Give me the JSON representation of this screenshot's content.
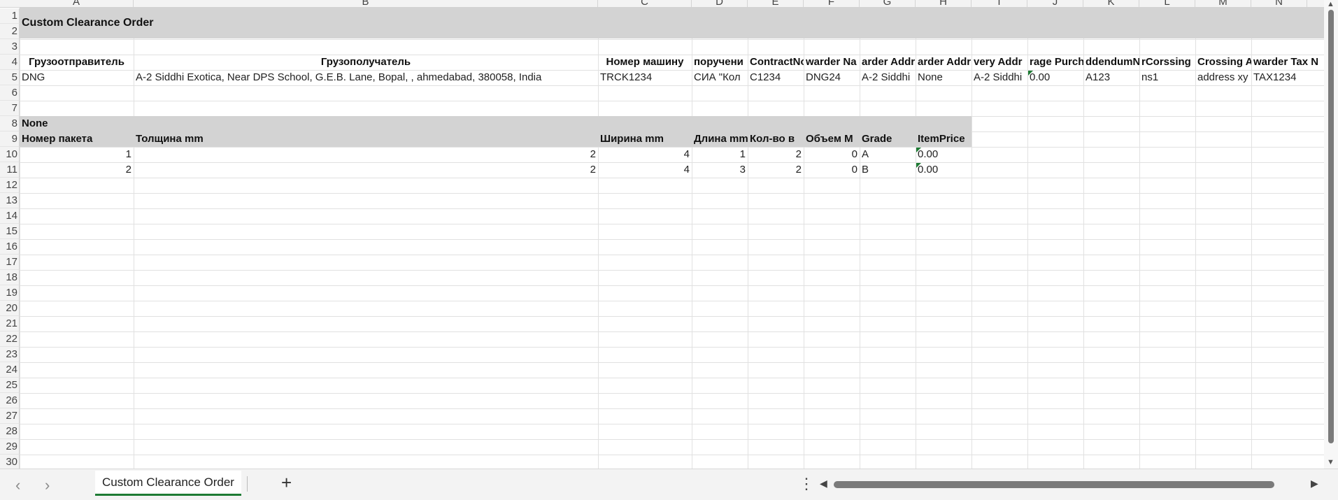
{
  "columns": [
    "A",
    "B",
    "C",
    "D",
    "E",
    "F",
    "G",
    "H",
    "I",
    "J",
    "K",
    "L",
    "M",
    "N"
  ],
  "rows": [
    "1",
    "2",
    "3",
    "4",
    "5",
    "6",
    "7",
    "8",
    "9",
    "10",
    "11",
    "12",
    "13",
    "14",
    "15",
    "16",
    "17",
    "18",
    "19",
    "20",
    "21",
    "22",
    "23",
    "24",
    "25",
    "26",
    "27",
    "28",
    "29",
    "30"
  ],
  "title": "Custom Clearance Order",
  "header": {
    "a": "Грузоотправитель",
    "b": "Грузополучатель",
    "c": "Номер машину",
    "d": "поручени",
    "e": "ContractNo",
    "f": "warder Na",
    "g": "arder Addr",
    "h": "arder Addr",
    "i": "very Addr",
    "j": "rage Purch",
    "k": "ddendumN",
    "l": "rCorssing",
    "m": "Crossing A",
    "n": "warder Tax N"
  },
  "record": {
    "a": "DNG",
    "b": "A-2 Siddhi Exotica, Near DPS School, G.E.B. Lane, Bopal, , ahmedabad, 380058, India",
    "c": "TRCK1234",
    "d": "СИА \"Кол",
    "e": "C1234",
    "f": "DNG24",
    "g": "A-2 Siddhi",
    "h": "None",
    "i": "A-2 Siddhi",
    "j": "0.00",
    "k": "A123",
    "l": "ns1",
    "m": "address xy",
    "n": "TAX1234"
  },
  "section_title": "None",
  "items_header": {
    "a": "Номер пакета",
    "b": "Толщина mm",
    "c": "Ширина mm",
    "d": "Длина mm",
    "e": "Кол-во в",
    "f": "Объем M",
    "g": "Grade",
    "h": "ItemPrice"
  },
  "items": [
    {
      "a": "1",
      "b": "2",
      "c": "4",
      "d": "1",
      "e": "2",
      "f": "0",
      "g": "A",
      "h": "0.00"
    },
    {
      "a": "2",
      "b": "2",
      "c": "4",
      "d": "3",
      "e": "2",
      "f": "0",
      "g": "B",
      "h": "0.00"
    }
  ],
  "sheet_tab": "Custom Clearance Order",
  "add_sheet": "+",
  "nav_prev": "‹",
  "nav_next": "›",
  "more_menu": "⋮",
  "colors": {
    "band": "#d3d3d3",
    "tab_underline": "#1e7b34",
    "error_triangle": "#1e7b34"
  }
}
